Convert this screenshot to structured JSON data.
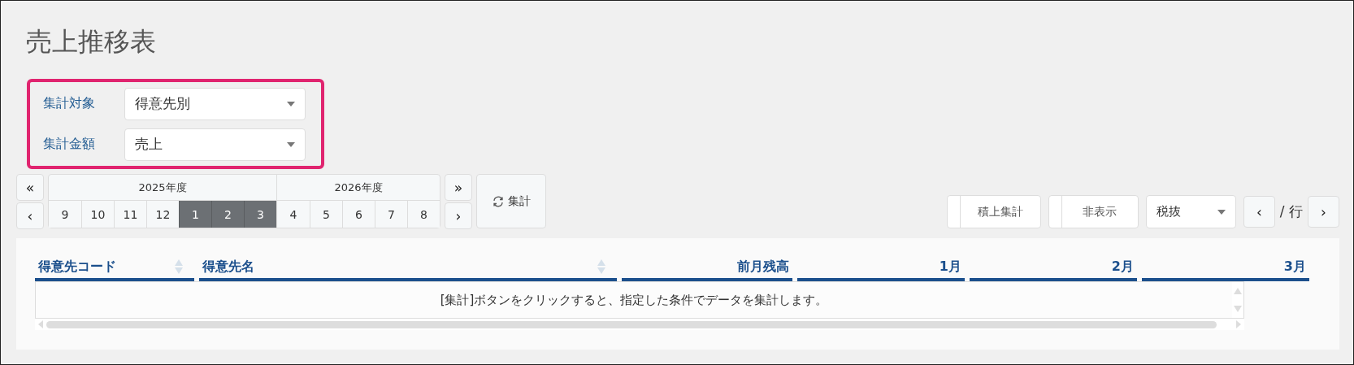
{
  "title": "売上推移表",
  "filters": [
    {
      "label": "集計対象",
      "value": "得意先別"
    },
    {
      "label": "集計金額",
      "value": "売上"
    }
  ],
  "period": {
    "first_button": "«",
    "prev_button": "‹",
    "next_button": "›",
    "last_button": "»",
    "years": [
      {
        "label": "2025年度",
        "months": [
          {
            "label": "9",
            "selected": false
          },
          {
            "label": "10",
            "selected": false
          },
          {
            "label": "11",
            "selected": false
          },
          {
            "label": "12",
            "selected": false
          },
          {
            "label": "1",
            "selected": true
          },
          {
            "label": "2",
            "selected": true
          },
          {
            "label": "3",
            "selected": true
          }
        ]
      },
      {
        "label": "2026年度",
        "months": [
          {
            "label": "4",
            "selected": false
          },
          {
            "label": "5",
            "selected": false
          },
          {
            "label": "6",
            "selected": false
          },
          {
            "label": "7",
            "selected": false
          },
          {
            "label": "8",
            "selected": false
          }
        ]
      }
    ]
  },
  "aggregate_button": "集計",
  "toolbar": {
    "cumulative_button": "積上集計",
    "hide_button": "非表示",
    "tax_select": "税抜",
    "prev_button": "‹",
    "row_label": "/ 行",
    "next_button": "›"
  },
  "table": {
    "columns": [
      {
        "label": "得意先コード",
        "kind": "text",
        "sortable": true
      },
      {
        "label": "得意先名",
        "kind": "text",
        "sortable": true
      },
      {
        "label": "前月残高",
        "kind": "amount",
        "sortable": false
      },
      {
        "label": "1月",
        "kind": "amount",
        "sortable": false
      },
      {
        "label": "2月",
        "kind": "amount",
        "sortable": false
      },
      {
        "label": "3月",
        "kind": "amount",
        "sortable": false
      }
    ],
    "empty_message": "[集計]ボタンをクリックすると、指定した条件でデータを集計します。"
  }
}
